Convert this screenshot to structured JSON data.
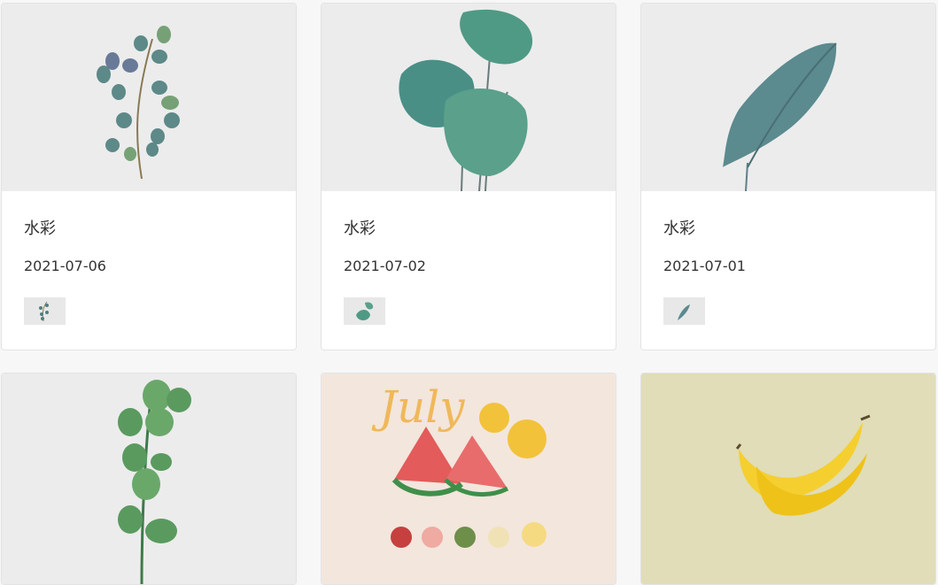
{
  "cards": [
    {
      "title": "水彩",
      "date": "2021-07-06",
      "image": "eucalyptus-watercolor"
    },
    {
      "title": "水彩",
      "date": "2021-07-02",
      "image": "monstera-watercolor"
    },
    {
      "title": "水彩",
      "date": "2021-07-01",
      "image": "banana-leaf-watercolor"
    },
    {
      "title": "",
      "date": "",
      "image": "eucalyptus-stem-watercolor"
    },
    {
      "title": "",
      "date": "",
      "image": "july-watermelon-lemon-watercolor",
      "lettering": "July"
    },
    {
      "title": "",
      "date": "",
      "image": "banana-watercolor"
    }
  ]
}
